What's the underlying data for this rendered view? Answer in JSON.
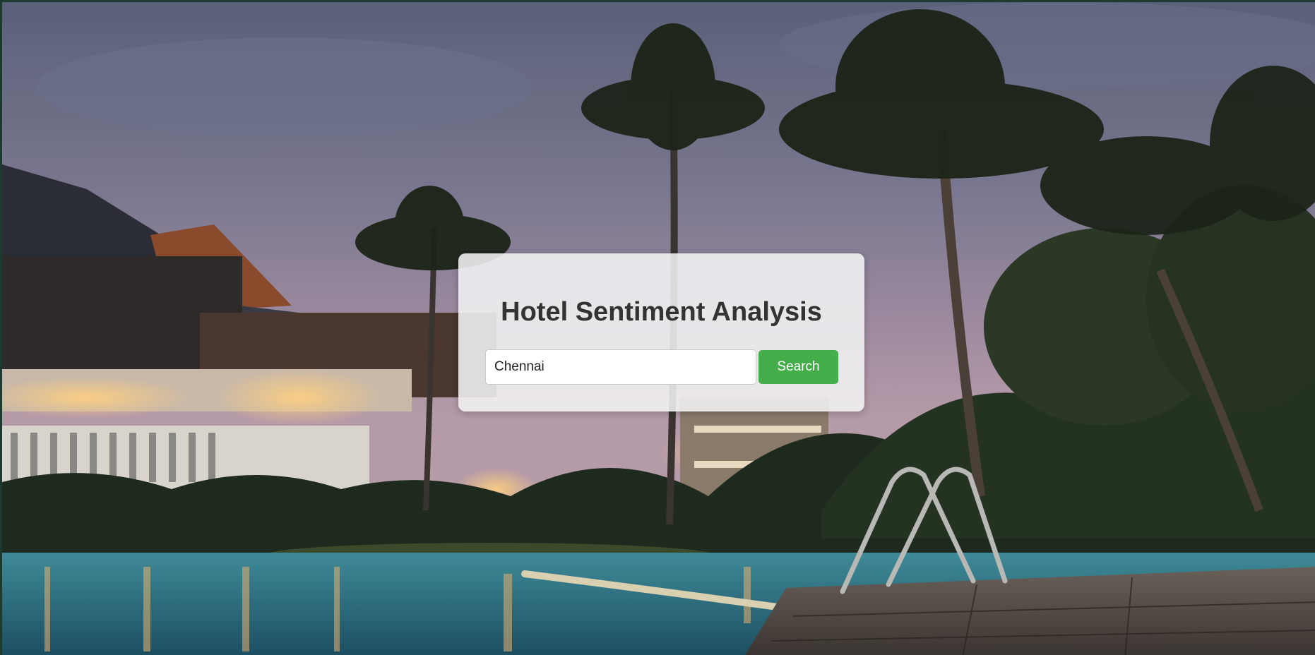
{
  "card": {
    "title": "Hotel Sentiment Analysis"
  },
  "search": {
    "value": "Chennai",
    "button_label": "Search"
  },
  "colors": {
    "button_bg": "#43ae4a",
    "title_text": "#333333",
    "card_bg": "#f2f2f4"
  }
}
